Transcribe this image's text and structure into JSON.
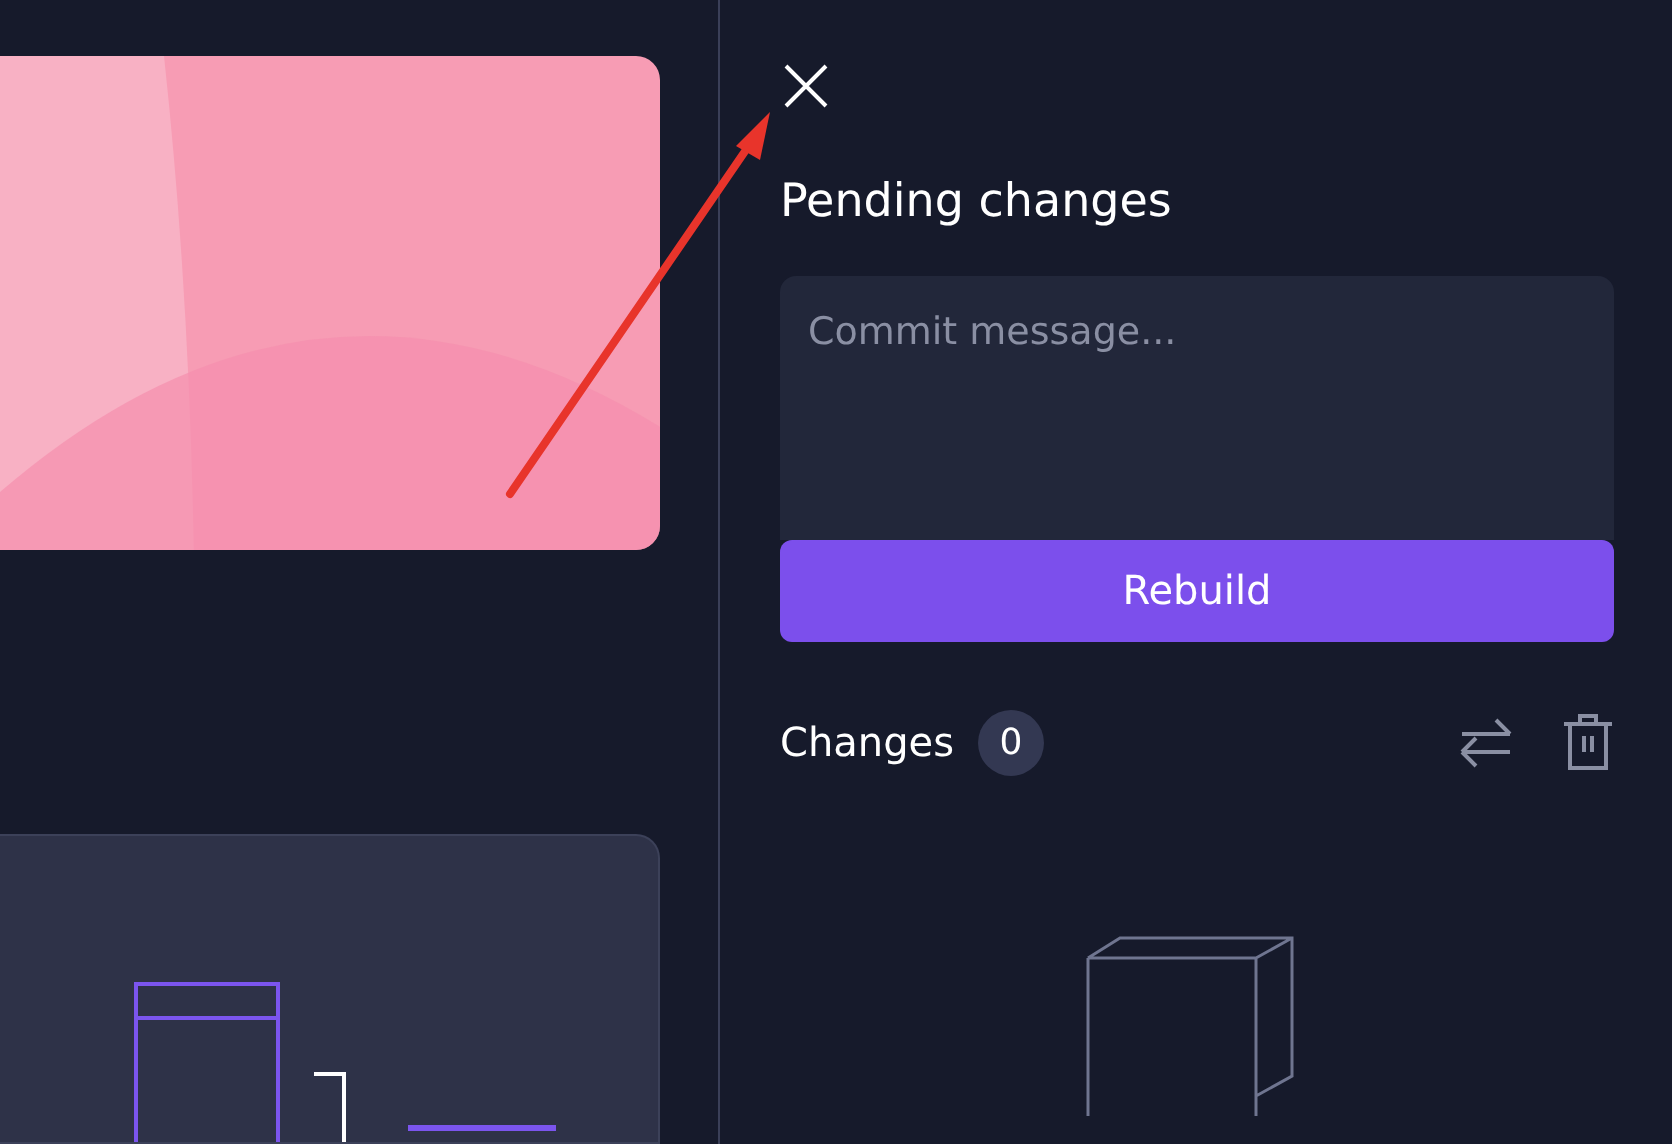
{
  "panel": {
    "title": "Pending changes",
    "commit": {
      "placeholder": "Commit message..."
    },
    "button": "Rebuild",
    "changes": {
      "label": "Changes",
      "count": "0"
    }
  }
}
